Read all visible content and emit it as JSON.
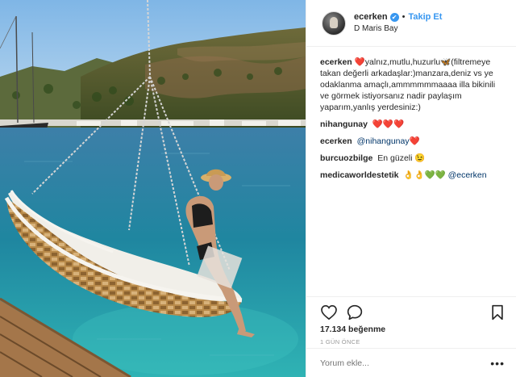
{
  "post": {
    "username": "ecerken",
    "verified_mark": "✔",
    "separator": "•",
    "follow_label": "Takip Et",
    "location": "D Maris Bay",
    "colors": {
      "accent": "#3897f0",
      "text": "#262626",
      "muted": "#999999",
      "divider": "#efefef"
    }
  },
  "comments": [
    {
      "user": "ecerken",
      "text": "❤️yalnız,mutlu,huzurlu🦋(filtremeye takan değerli arkadaşlar:)manzara,deniz vs ye odaklanma amaçlı,ammmmmmaaaa illa bikinili ve görmek istiyorsanız nadir paylaşım yaparım,yanlış yerdesiniz:)"
    },
    {
      "user": "nihangunay",
      "text": "❤️❤️❤️"
    },
    {
      "user": "ecerken",
      "mention": "@nihangunay",
      "text": "❤️"
    },
    {
      "user": "burcuozbilge",
      "text": "En güzeli 😉"
    },
    {
      "user": "medicaworldestetik",
      "text": "👌👌💚💚",
      "mention": "@ecerken"
    }
  ],
  "actions": {
    "like_icon": "heart-outline-icon",
    "comment_icon": "speech-bubble-icon",
    "save_icon": "bookmark-icon",
    "likes_label": "17.134 beğenme",
    "time_label": "1 GÜN ÖNCE"
  },
  "comment_box": {
    "placeholder": "Yorum ekle...",
    "more_label": "•••"
  }
}
